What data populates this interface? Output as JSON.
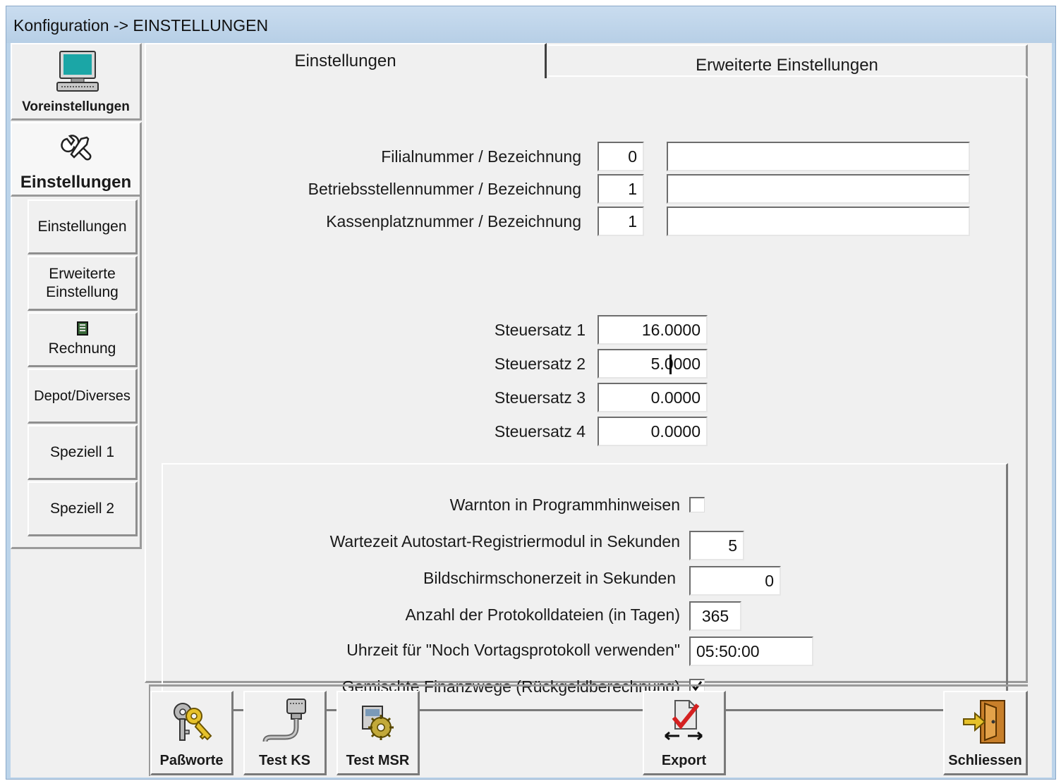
{
  "window": {
    "title": "Konfiguration -> EINSTELLUNGEN"
  },
  "sidebar": {
    "main_buttons": [
      {
        "label": "Voreinstellungen",
        "icon": "computer-icon"
      },
      {
        "label": "Einstellungen",
        "icon": "tools-icon"
      }
    ],
    "sub_buttons": [
      {
        "label": "Einstellungen"
      },
      {
        "label": "Erweiterte",
        "label2": "Einstellung"
      },
      {
        "label": "Rechnung",
        "icon": "book-icon"
      },
      {
        "label": "Depot/Diverses"
      },
      {
        "label": "Speziell 1"
      },
      {
        "label": "Speziell 2"
      }
    ]
  },
  "tabs": [
    {
      "label": "Einstellungen",
      "active": true
    },
    {
      "label": "Erweiterte Einstellungen",
      "active": false
    }
  ],
  "top_fields": [
    {
      "label": "Filialnummer / Bezeichnung",
      "number": "0",
      "name": ""
    },
    {
      "label": "Betriebsstellennummer / Bezeichnung",
      "number": "1",
      "name": ""
    },
    {
      "label": "Kassenplatznummer / Bezeichnung",
      "number": "1",
      "name": ""
    }
  ],
  "tax_rates": [
    {
      "label": "Steuersatz 1",
      "value": "16.0000"
    },
    {
      "label": "Steuersatz 2",
      "value": "5.0000"
    },
    {
      "label": "Steuersatz 3",
      "value": "0.0000"
    },
    {
      "label": "Steuersatz 4",
      "value": "0.0000"
    }
  ],
  "options": {
    "warnton": {
      "label": "Warnton in Programmhinweisen",
      "checked": false
    },
    "wartezeit": {
      "label": "Wartezeit Autostart-Registriermodul in Sekunden",
      "value": "5"
    },
    "bildschirm": {
      "label": "Bildschirmschonerzeit in Sekunden",
      "value": "0"
    },
    "protokoll": {
      "label": "Anzahl der Protokolldateien (in Tagen)",
      "value": "365"
    },
    "uhrzeit": {
      "label": "Uhrzeit für \"Noch Vortagsprotokoll verwenden\"",
      "value": "05:50:00"
    },
    "gemischt": {
      "label": "Gemischte Finanzwege (Rückgeldberechnung)",
      "checked": true
    }
  },
  "toolbar": {
    "passworte": "Paßworte",
    "test_ks": "Test KS",
    "test_msr": "Test MSR",
    "export": "Export",
    "schliessen": "Schliessen"
  },
  "colors": {
    "titlebar": "#bcd4ea",
    "face": "#f0f0f0",
    "check_red": "#d42020"
  }
}
